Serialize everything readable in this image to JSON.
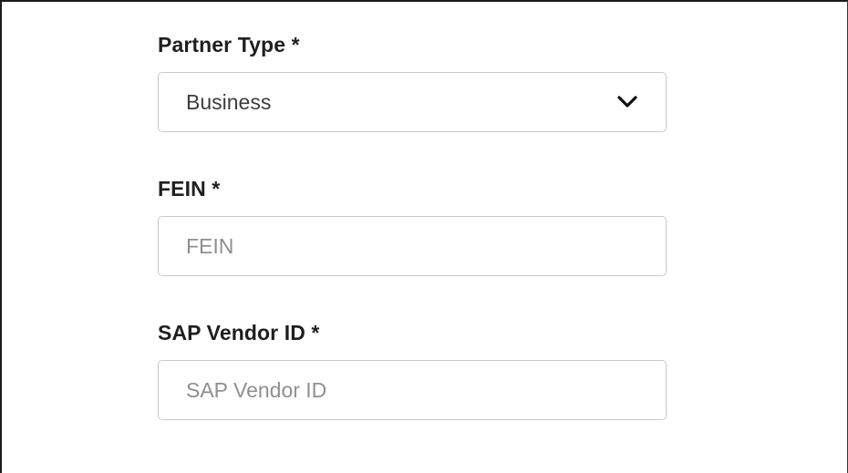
{
  "form": {
    "partner_type": {
      "label": "Partner Type *",
      "selected_value": "Business",
      "icon": "chevron-down-icon"
    },
    "fein": {
      "label": "FEIN *",
      "placeholder": "FEIN",
      "value": ""
    },
    "sap_vendor_id": {
      "label": "SAP Vendor ID *",
      "placeholder": "SAP Vendor ID",
      "value": ""
    }
  },
  "colors": {
    "label": "#1f1f1f",
    "border": "#c9c9c9",
    "placeholder": "#8f8f8f",
    "value": "#3d3d3d"
  }
}
